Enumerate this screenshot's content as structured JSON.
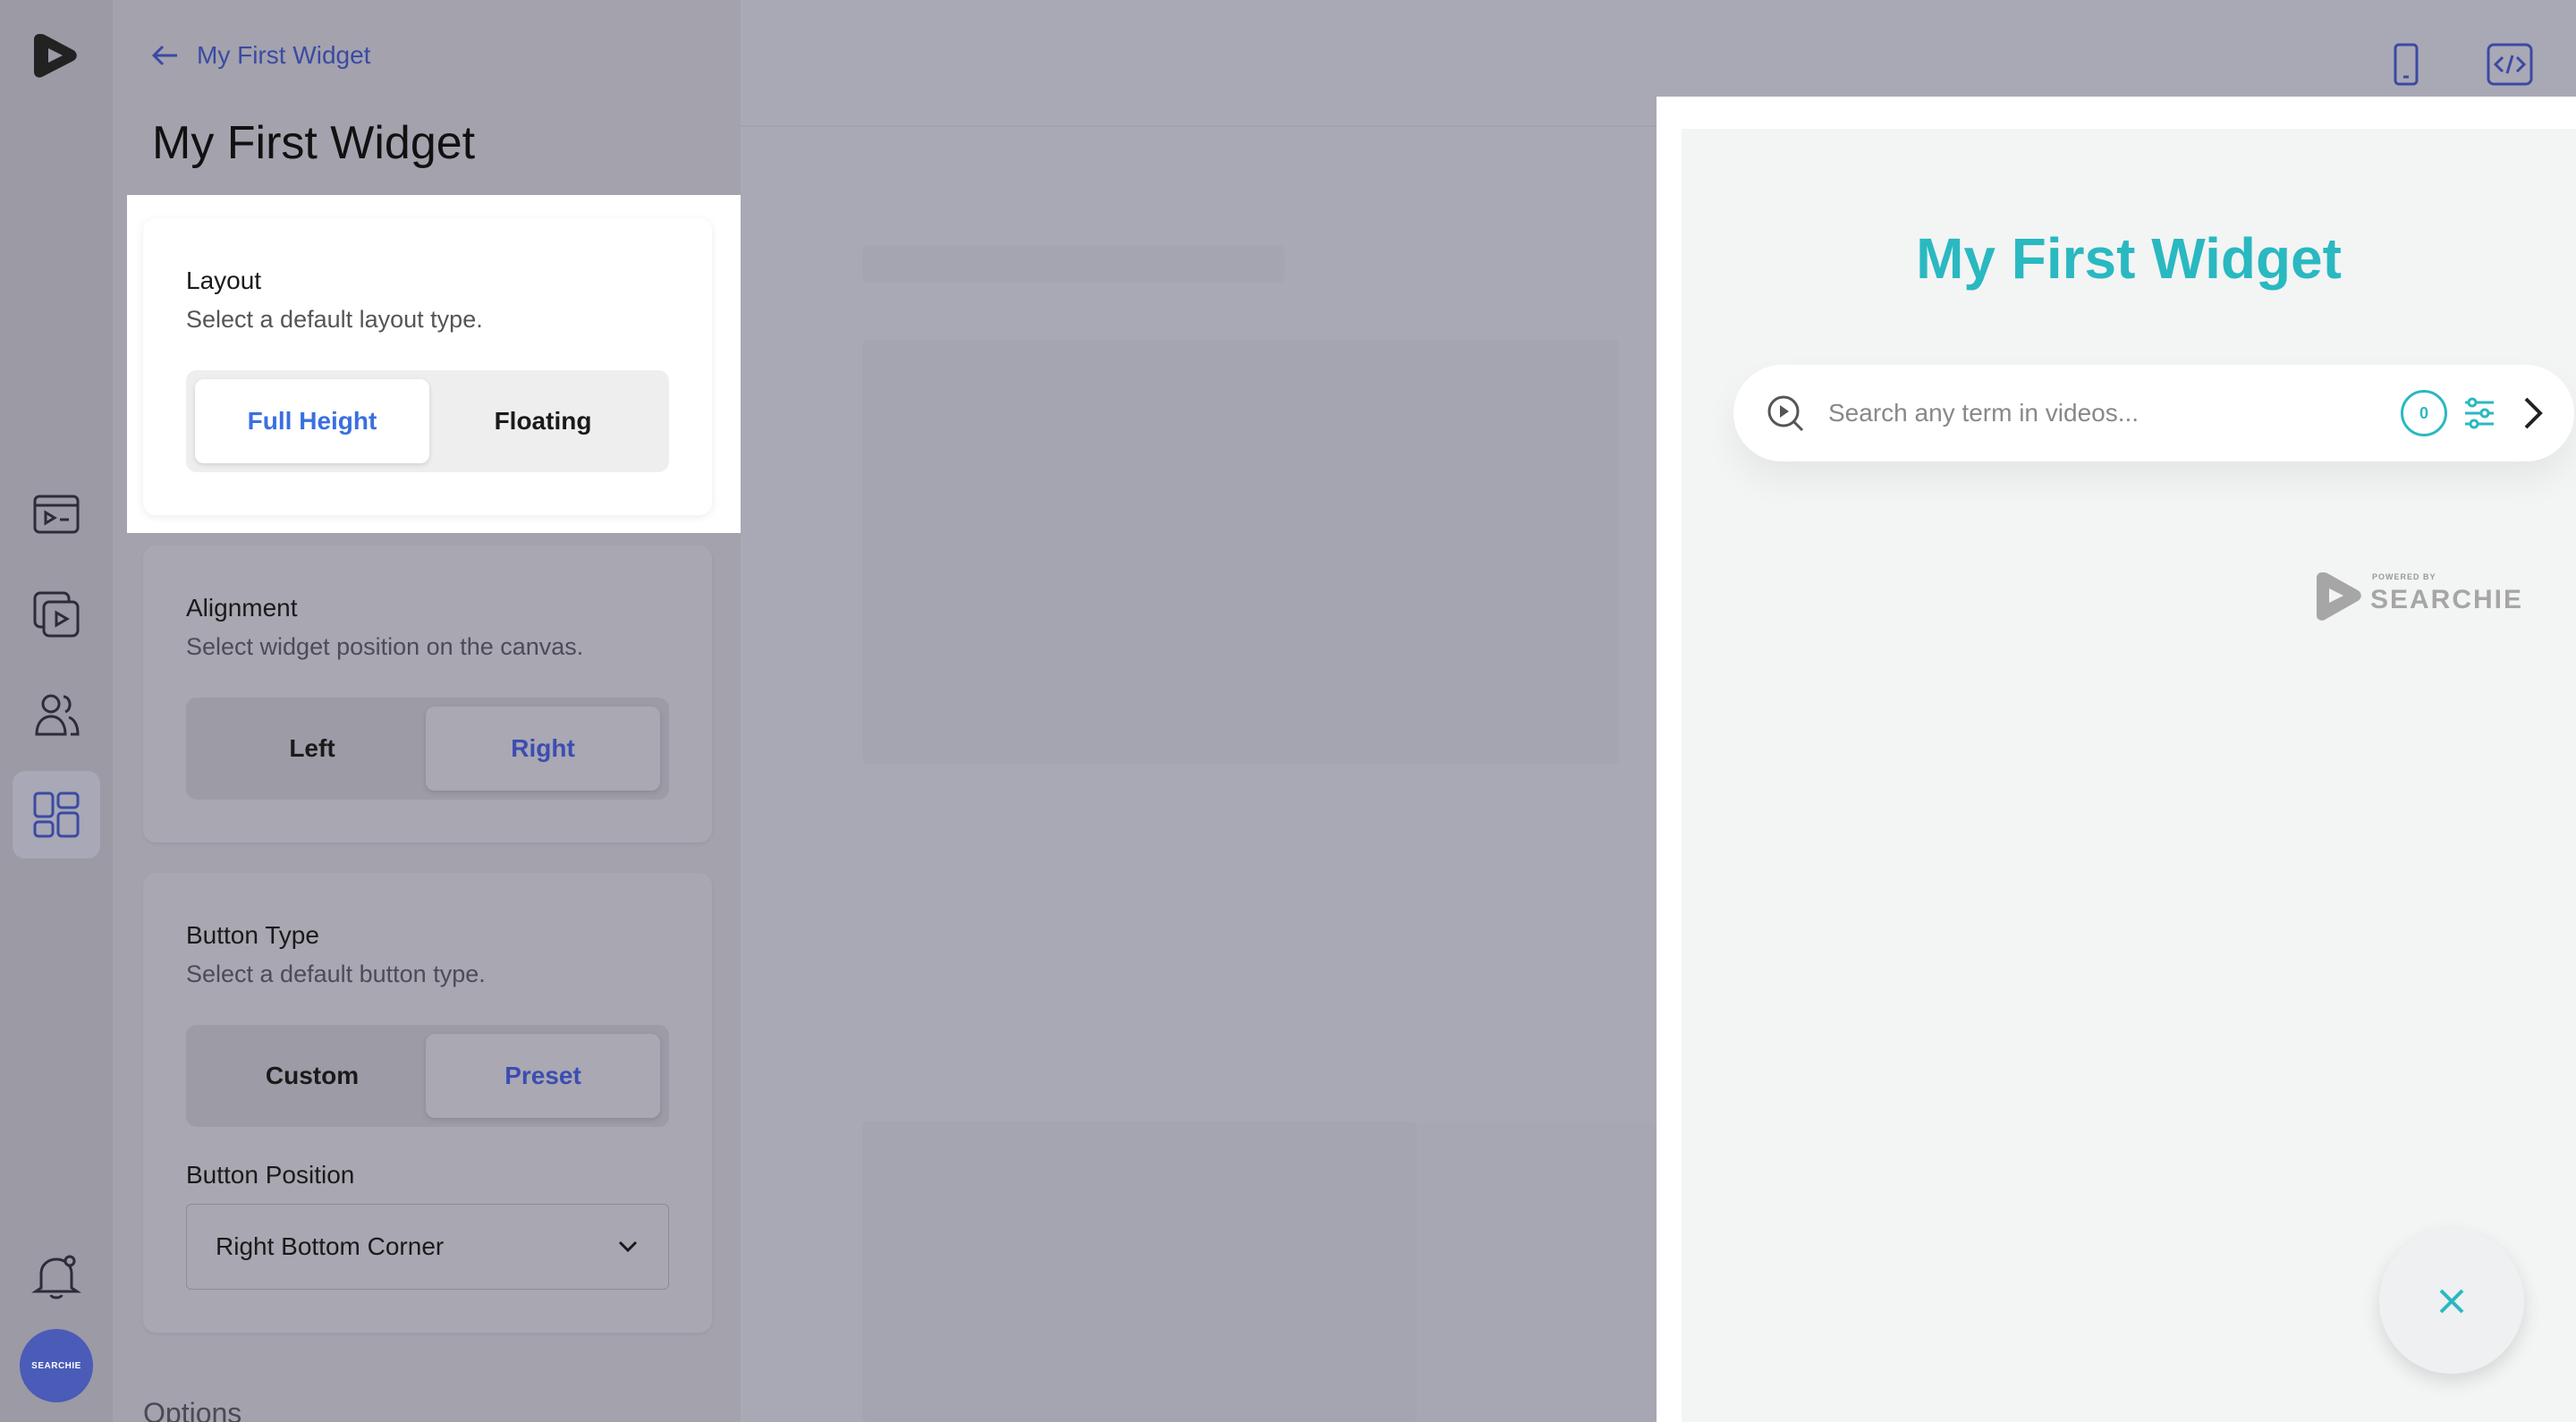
{
  "sidebar": {
    "icons": [
      "app-logo-icon",
      "video-player-icon",
      "video-library-icon",
      "users-icon",
      "widgets-icon",
      "bell-icon"
    ],
    "avatar_text": "SEARCHIE"
  },
  "panel": {
    "back_label": "My First Widget",
    "title": "My First Widget",
    "layout": {
      "label": "Layout",
      "description": "Select a default layout type.",
      "options": [
        "Full Height",
        "Floating"
      ],
      "selected": "Full Height"
    },
    "alignment": {
      "label": "Alignment",
      "description": "Select widget position on the canvas.",
      "options": [
        "Left",
        "Right"
      ],
      "selected": "Right"
    },
    "button_type": {
      "label": "Button Type",
      "description": "Select a default button type.",
      "options": [
        "Custom",
        "Preset"
      ],
      "selected": "Preset"
    },
    "button_position": {
      "label": "Button Position",
      "value": "Right Bottom Corner"
    },
    "options_heading": "Options"
  },
  "toolbar": {
    "icons": [
      "mobile-preview-icon",
      "embed-code-icon"
    ]
  },
  "widget": {
    "title": "My First Widget",
    "search_placeholder": "Search any term in videos...",
    "result_count": "0",
    "powered_by": "POWERED BY",
    "brand": "SEARCHIE",
    "accent_color": "#2ab8c1"
  }
}
